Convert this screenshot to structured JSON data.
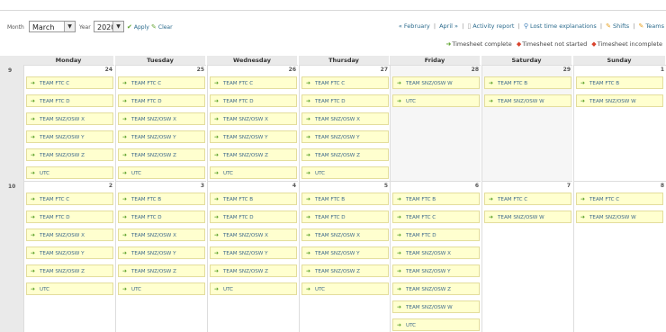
{
  "toolbar": {
    "month_label": "Month",
    "month_value": "March",
    "year_label": "Year",
    "year_value": "2020",
    "apply_label": "Apply",
    "clear_label": "Clear"
  },
  "nav_links": {
    "prev": "« February",
    "sep": "|",
    "next": "April »",
    "activity_report": "Activity report",
    "lost_time": "Lost time explanations",
    "shifts": "Shifts",
    "teams": "Teams"
  },
  "legend": {
    "complete": "Timesheet complete",
    "not_started": "Timesheet not started",
    "incomplete": "Timesheet incomplete",
    "colors": {
      "complete": "#5aa028",
      "not_started": "#d9442e",
      "incomplete": "#d9442e"
    }
  },
  "weekdays": [
    "Monday",
    "Tuesday",
    "Wednesday",
    "Thursday",
    "Friday",
    "Saturday",
    "Sunday"
  ],
  "weeks": [
    {
      "week": "9",
      "days": [
        {
          "num": "24",
          "events": [
            "TEAM FTC C",
            "TEAM FTC D",
            "TEAM SNZ/OSW X",
            "TEAM SNZ/OSW Y",
            "TEAM SNZ/OSW Z",
            "UTC"
          ]
        },
        {
          "num": "25",
          "events": [
            "TEAM FTC C",
            "TEAM FTC D",
            "TEAM SNZ/OSW X",
            "TEAM SNZ/OSW Y",
            "TEAM SNZ/OSW Z",
            "UTC"
          ]
        },
        {
          "num": "26",
          "events": [
            "TEAM FTC C",
            "TEAM FTC D",
            "TEAM SNZ/OSW X",
            "TEAM SNZ/OSW Y",
            "TEAM SNZ/OSW Z",
            "UTC"
          ]
        },
        {
          "num": "27",
          "events": [
            "TEAM FTC C",
            "TEAM FTC D",
            "TEAM SNZ/OSW X",
            "TEAM SNZ/OSW Y",
            "TEAM SNZ/OSW Z",
            "UTC"
          ]
        },
        {
          "num": "28",
          "events": [
            "TEAM SNZ/OSW W",
            "UTC"
          ]
        },
        {
          "num": "29",
          "events": [
            "TEAM FTC B",
            "TEAM SNZ/OSW W"
          ]
        },
        {
          "num": "1",
          "events": [
            "TEAM FTC B",
            "TEAM SNZ/OSW W"
          ]
        }
      ]
    },
    {
      "week": "10",
      "days": [
        {
          "num": "2",
          "events": [
            "TEAM FTC C",
            "TEAM FTC D",
            "TEAM SNZ/OSW X",
            "TEAM SNZ/OSW Y",
            "TEAM SNZ/OSW Z",
            "UTC"
          ]
        },
        {
          "num": "3",
          "events": [
            "TEAM FTC B",
            "TEAM FTC D",
            "TEAM SNZ/OSW X",
            "TEAM SNZ/OSW Y",
            "TEAM SNZ/OSW Z",
            "UTC"
          ]
        },
        {
          "num": "4",
          "events": [
            "TEAM FTC B",
            "TEAM FTC D",
            "TEAM SNZ/OSW X",
            "TEAM SNZ/OSW Y",
            "TEAM SNZ/OSW Z",
            "UTC"
          ]
        },
        {
          "num": "5",
          "events": [
            "TEAM FTC B",
            "TEAM FTC D",
            "TEAM SNZ/OSW X",
            "TEAM SNZ/OSW Y",
            "TEAM SNZ/OSW Z",
            "UTC"
          ]
        },
        {
          "num": "6",
          "events": [
            "TEAM FTC B",
            "TEAM FTC C",
            "TEAM FTC D",
            "TEAM SNZ/OSW X",
            "TEAM SNZ/OSW Y",
            "TEAM SNZ/OSW Z",
            "TEAM SNZ/OSW W",
            "UTC"
          ]
        },
        {
          "num": "7",
          "events": [
            "TEAM FTC C",
            "TEAM SNZ/OSW W"
          ]
        },
        {
          "num": "8",
          "events": [
            "TEAM FTC C",
            "TEAM SNZ/OSW W"
          ]
        }
      ]
    }
  ]
}
